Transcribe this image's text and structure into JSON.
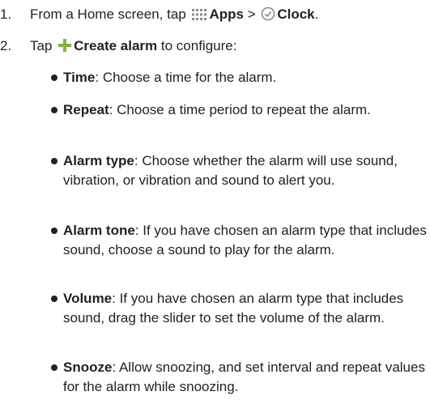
{
  "steps": [
    {
      "number": "1.",
      "prefix": "From a Home screen, tap ",
      "apps_label": "Apps",
      "separator": " > ",
      "clock_label": "Clock",
      "suffix": "."
    },
    {
      "number": "2.",
      "prefix": "Tap ",
      "create_label": "Create alarm",
      "suffix": " to configure:"
    }
  ],
  "bullets": [
    {
      "term": "Time",
      "text": ": Choose a time for the alarm."
    },
    {
      "term": "Repeat",
      "text": ": Choose a time period to repeat the alarm."
    },
    {
      "term": "Alarm type",
      "text": ": Choose whether the alarm will use sound, vibration, or vibration and sound to alert you."
    },
    {
      "term": "Alarm tone",
      "text": ": If you have chosen an alarm type that includes sound, choose a sound to play for the alarm."
    },
    {
      "term": "Volume",
      "text": ": If you have chosen an alarm type that includes sound, drag the slider to set the volume of the alarm."
    },
    {
      "term": "Snooze",
      "text": ": Allow snoozing, and set interval and repeat values for the alarm while snoozing."
    }
  ],
  "icons": {
    "apps": "apps-grid-icon",
    "clock": "clock-icon",
    "create": "plus-icon",
    "plus_color": "#7ab648",
    "icon_gray": "#8a8a8a"
  }
}
